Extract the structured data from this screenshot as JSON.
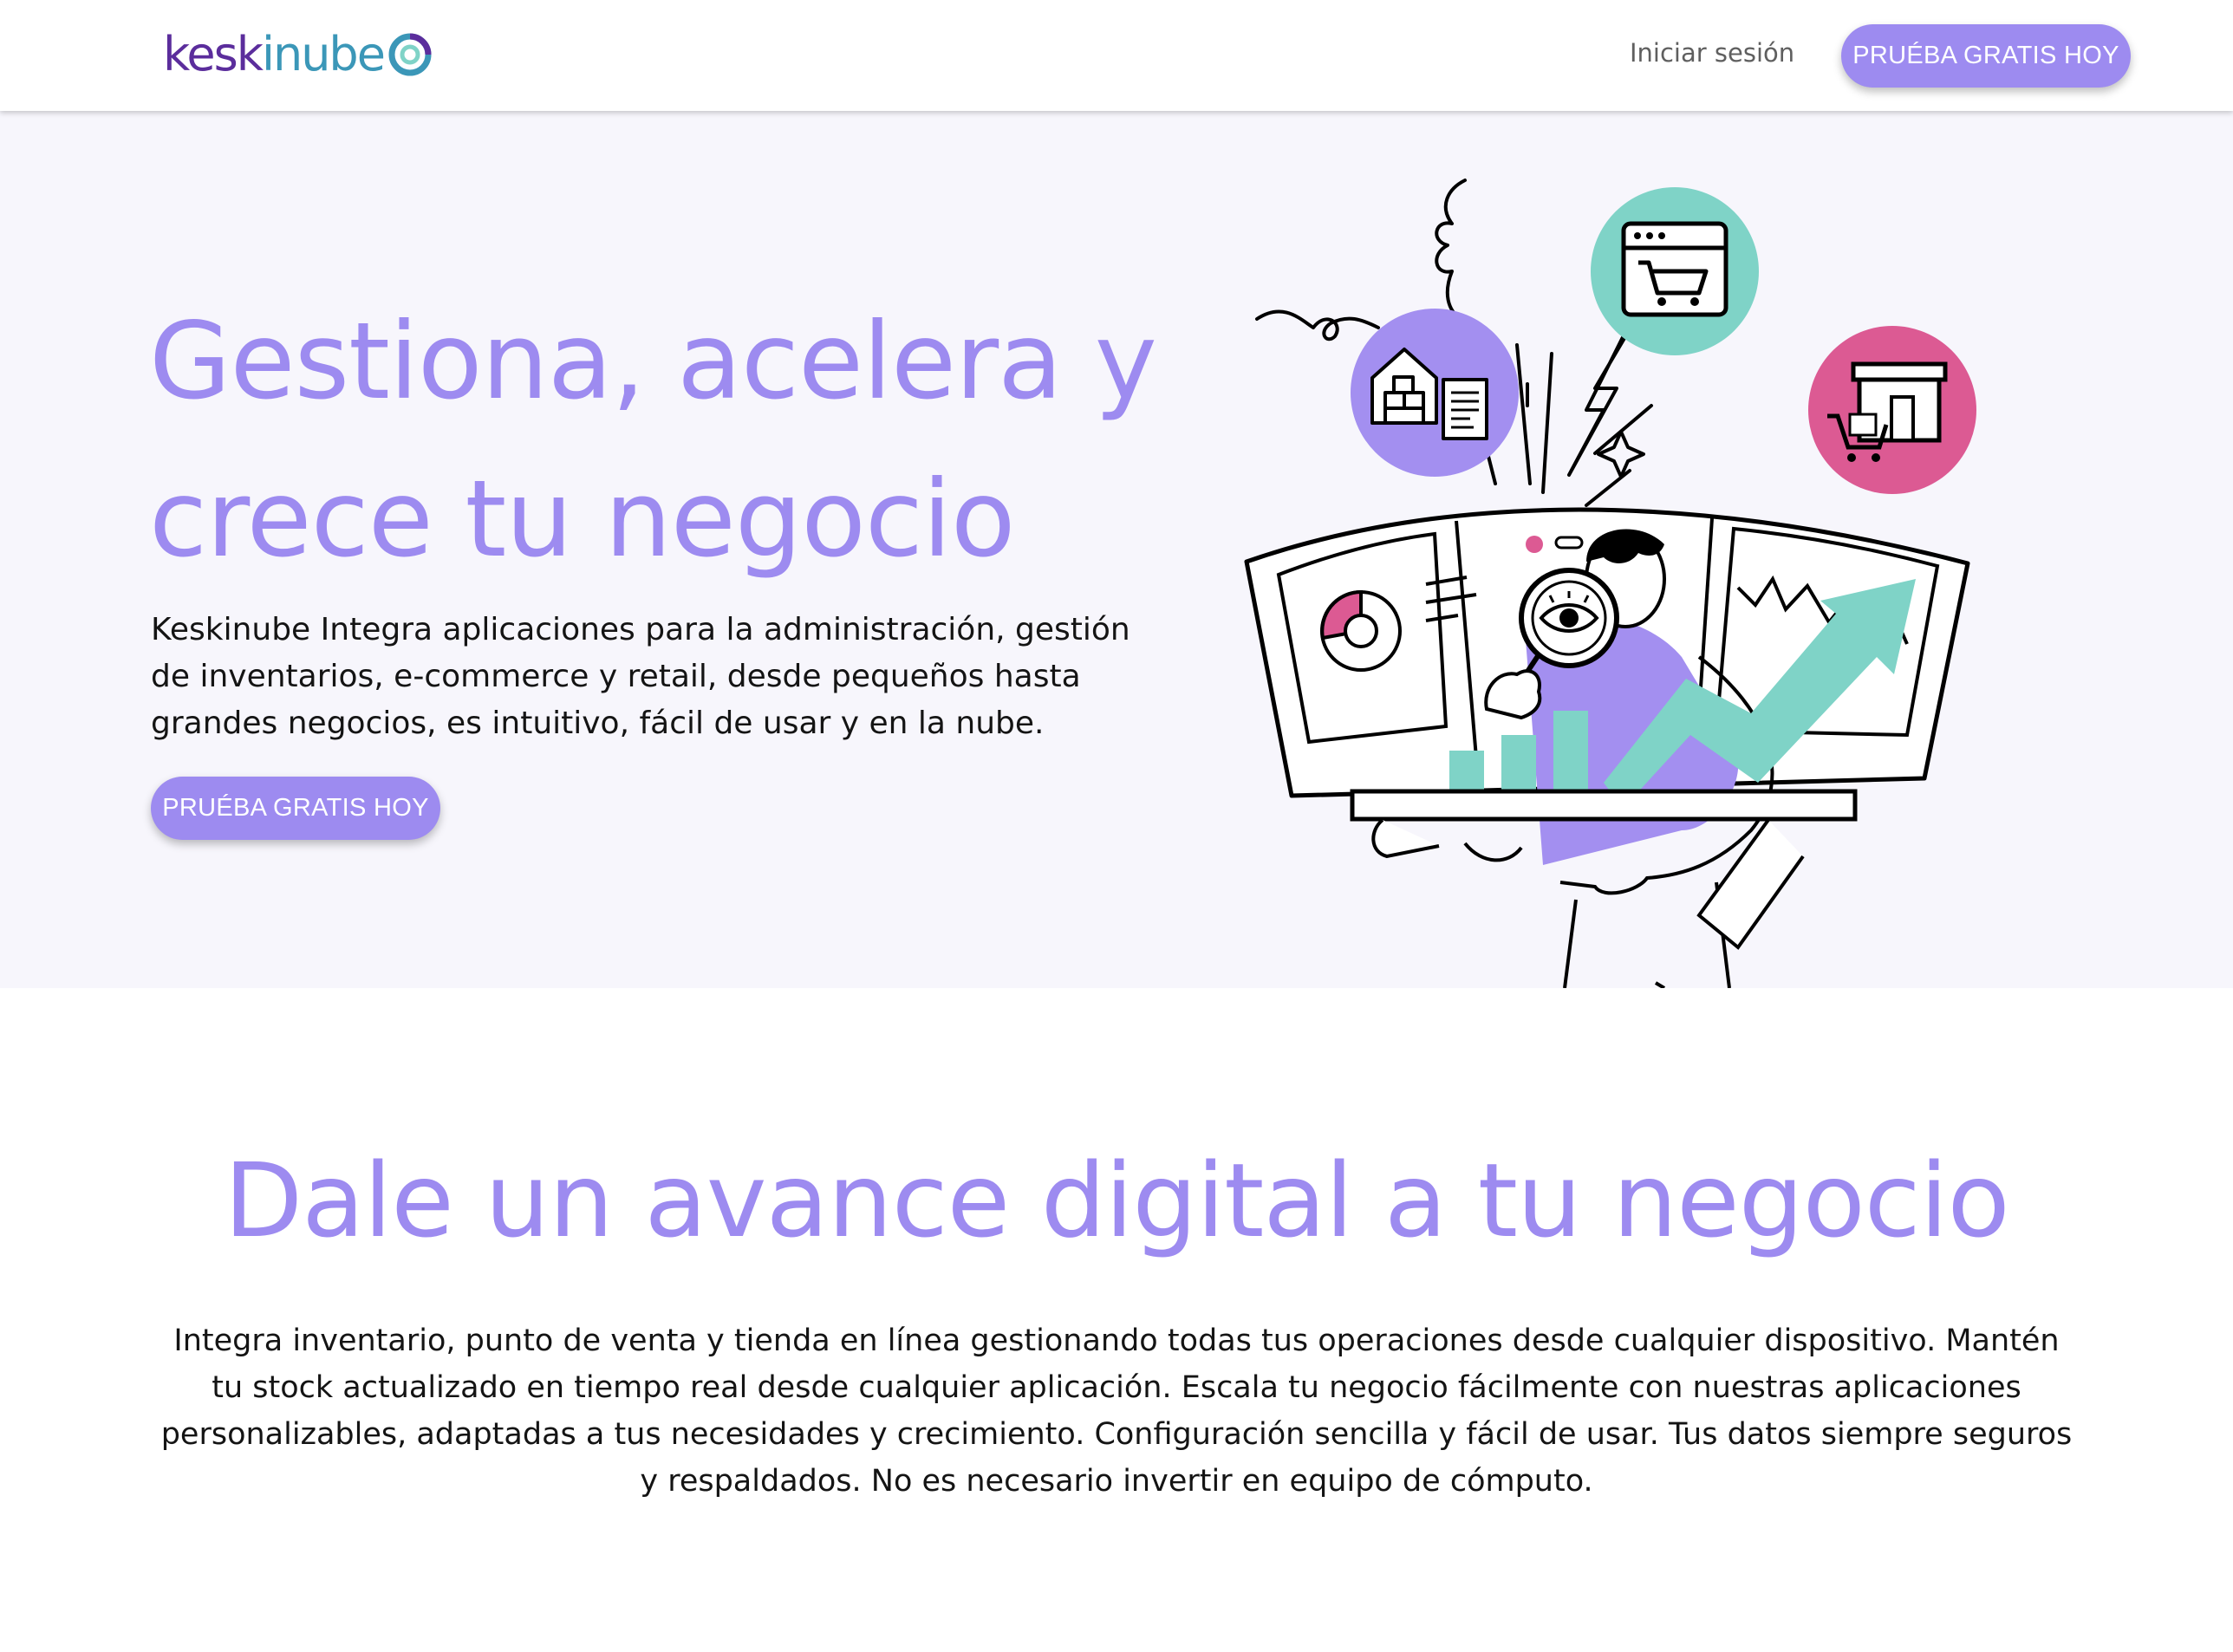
{
  "header": {
    "logo_text_part1": "kesk",
    "logo_text_part2": "inube",
    "login_label": "Iniciar sesión",
    "cta_label": "PRUÉBA GRATIS HOY"
  },
  "hero": {
    "title": "Gestiona, acelera y crece tu negocio",
    "description": "Keskinube Integra aplicaciones para la administración, gestión de inventarios, e-commerce y retail, desde pequeños hasta grandes negocios, es intuitivo, fácil de usar y en la nube.",
    "cta_label": "PRUÉBA GRATIS HOY",
    "illustration_icons": [
      "warehouse-icon",
      "shopping-cart-browser-icon",
      "storefront-icon",
      "pie-chart-icon",
      "magnifier-eye-icon",
      "growth-arrow-icon"
    ]
  },
  "section": {
    "title": "Dale un avance digital a tu negocio",
    "description": "Integra inventario, punto de venta y tienda en línea gestionando todas tus operaciones desde cualquier dispositivo. Mantén tu stock actualizado en tiempo real desde cualquier aplicación. Escala tu negocio fácilmente con nuestras aplicaciones personalizables, adaptadas a tus necesidades y crecimiento. Configuración sencilla y fácil de usar. Tus datos siempre seguros y respaldados. No es necesario invertir en equipo de cómputo."
  },
  "colors": {
    "accent": "#9d8bf0",
    "purple_circle": "#a38ff0",
    "teal": "#7fd3c7",
    "pink": "#dc5a93",
    "hero_bg": "#f7f6fc",
    "logo_dark": "#5b2d9c",
    "logo_light": "#3b97b8"
  }
}
